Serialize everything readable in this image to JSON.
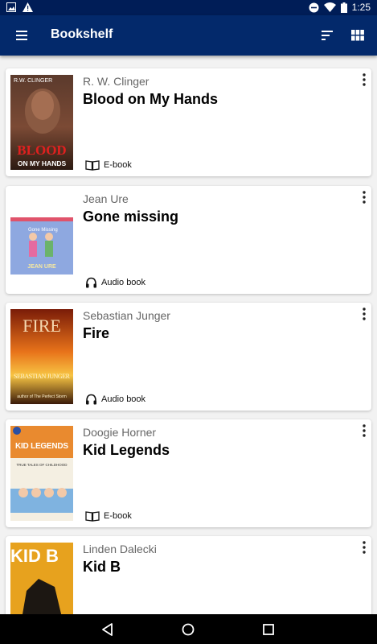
{
  "status_bar": {
    "time": "1:25",
    "icons": [
      "image-icon",
      "warning-icon",
      "dnd-icon",
      "wifi-icon",
      "battery-icon"
    ]
  },
  "app_bar": {
    "title": "Bookshelf",
    "icons": [
      "menu-icon",
      "sort-icon",
      "grid-view-icon"
    ],
    "color": "#03296b"
  },
  "books": [
    {
      "author": "R. W. Clinger",
      "title": "Blood on My Hands",
      "format": "E-book",
      "format_icon": "book-open-icon",
      "cover": {
        "top_text": "R.W. CLINGER",
        "main": "BLOOD",
        "sub": "ON MY HANDS"
      }
    },
    {
      "author": "Jean Ure",
      "title": "Gone missing",
      "format": "Audio book",
      "format_icon": "headphones-icon",
      "cover": {
        "main": "Gone Missing",
        "sub": "JEAN URE"
      }
    },
    {
      "author": "Sebastian Junger",
      "title": "Fire",
      "format": "Audio book",
      "format_icon": "headphones-icon",
      "cover": {
        "main": "FIRE",
        "sub": "SEBASTIAN JUNGER",
        "note": "author of The Perfect Storm"
      }
    },
    {
      "author": "Doogie Horner",
      "title": "Kid Legends",
      "format": "E-book",
      "format_icon": "book-open-icon",
      "cover": {
        "main": "KID LEGENDS",
        "sub": "TRUE TALES OF CHILDHOOD"
      }
    },
    {
      "author": "Linden Dalecki",
      "title": "Kid B",
      "format": "",
      "format_icon": "",
      "cover": {
        "main": "KID B"
      }
    }
  ],
  "nav_bar": {
    "icons": [
      "back-icon",
      "home-icon",
      "recents-icon"
    ]
  }
}
